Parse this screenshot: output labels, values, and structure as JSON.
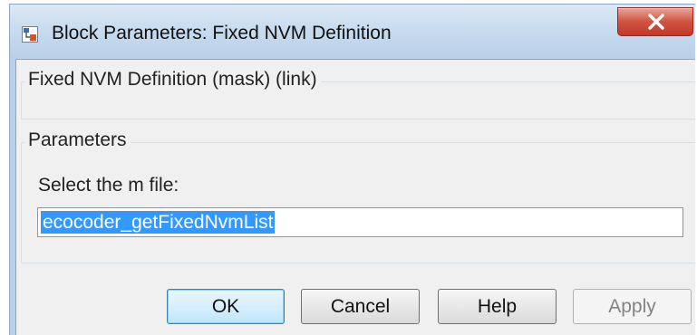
{
  "window": {
    "title": "Block Parameters: Fixed NVM Definition",
    "icon": "simulink-block-icon",
    "close_icon": "close-x-icon"
  },
  "description_group": {
    "title": "Fixed NVM Definition (mask) (link)"
  },
  "parameters_group": {
    "title": "Parameters",
    "field_label": "Select the m file:",
    "field_value": "ecocoder_getFixedNvmList"
  },
  "buttons": {
    "ok": "OK",
    "cancel": "Cancel",
    "help": "Help",
    "apply": "Apply"
  },
  "colors": {
    "selection": "#3399ff",
    "close_button": "#c7422e",
    "titlebar": "#c5d9ee"
  }
}
